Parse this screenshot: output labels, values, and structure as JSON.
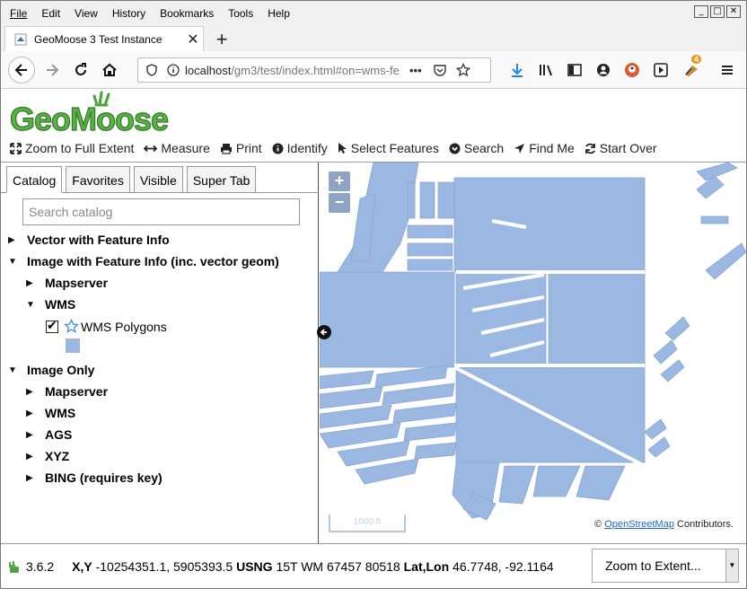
{
  "browser": {
    "menu": [
      "File",
      "Edit",
      "View",
      "History",
      "Bookmarks",
      "Tools",
      "Help"
    ],
    "tab_title": "GeoMoose 3 Test Instance",
    "url_host": "localhost",
    "url_path": "/gm3/test/index.html#on=wms-fe",
    "window_buttons": [
      "minimize",
      "maximize",
      "close"
    ],
    "addon_badge": "4"
  },
  "app": {
    "logo_text": "GeoMoose",
    "toolbar": [
      {
        "icon": "expand-icon",
        "label": "Zoom to Full Extent"
      },
      {
        "icon": "arrows-h-icon",
        "label": "Measure"
      },
      {
        "icon": "print-icon",
        "label": "Print"
      },
      {
        "icon": "info-icon",
        "label": "Identify"
      },
      {
        "icon": "cursor-icon",
        "label": "Select Features"
      },
      {
        "icon": "search-icon",
        "label": "Search"
      },
      {
        "icon": "location-arrow-icon",
        "label": "Find Me"
      },
      {
        "icon": "refresh-icon",
        "label": "Start Over"
      }
    ]
  },
  "panel": {
    "tabs": [
      "Catalog",
      "Favorites",
      "Visible",
      "Super Tab"
    ],
    "active_tab": "Catalog",
    "search_placeholder": "Search catalog",
    "tree": {
      "group1": "Vector with Feature Info",
      "group2": "Image with Feature Info (inc. vector geom)",
      "group2_children": [
        "Mapserver",
        "WMS"
      ],
      "wms_layer": "WMS Polygons",
      "group3": "Image Only",
      "group3_children": [
        "Mapserver",
        "WMS",
        "AGS",
        "XYZ",
        "BING (requires key)"
      ]
    }
  },
  "map": {
    "zoom_in": "+",
    "zoom_out": "−",
    "scale_label": "1000 ft",
    "attribution_prefix": "©",
    "attribution_link": "OpenStreetMap",
    "attribution_suffix": "Contributors.",
    "feature_color": "#9bb8e3"
  },
  "status": {
    "version": "3.6.2",
    "xy_label": "X,Y",
    "xy_value": "-10254351.1, 5905393.5",
    "usng_label": "USNG",
    "usng_value": "15T WM 67457 80518",
    "latlon_label": "Lat,Lon",
    "latlon_value": "46.7748, -92.1164",
    "zoom_select": "Zoom to Extent..."
  }
}
